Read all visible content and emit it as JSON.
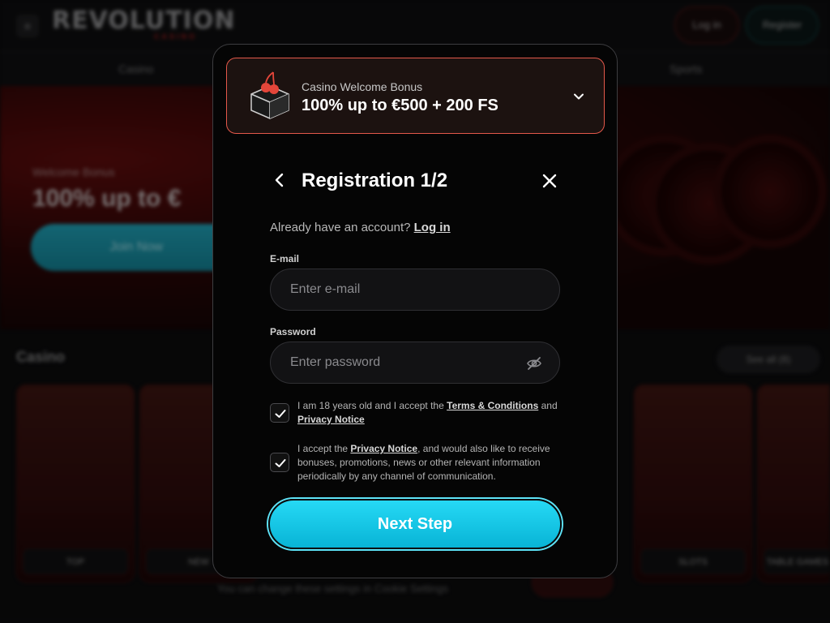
{
  "background": {
    "logo": "REVOLUTION",
    "logo_sub": "CASINO",
    "login_button": "Log in",
    "register_button": "Register",
    "nav": [
      "Casino",
      "Sports"
    ],
    "hero_subtitle": "Welcome Bonus",
    "hero_title": "100% up to €",
    "hero_button": "Join Now",
    "section_title": "Casino",
    "see_all": "See all (8)",
    "cards": [
      "TOP",
      "NEW",
      "SLOTS",
      "TABLE GAMES"
    ],
    "cookie_text": "You can change these settings in Cookie Settings",
    "accept_button": "Accept all"
  },
  "bonus": {
    "subtitle": "Casino Welcome Bonus",
    "title": "100% up to €500 + 200 FS",
    "accent_color": "#e4584a"
  },
  "header": {
    "title": "Registration 1/2"
  },
  "account_prompt": {
    "text": "Already have an account?",
    "link": "Log in"
  },
  "email": {
    "label": "E-mail",
    "placeholder": "Enter e-mail",
    "value": ""
  },
  "password": {
    "label": "Password",
    "placeholder": "Enter password",
    "value": "",
    "toggle_icon": "eye-off-icon"
  },
  "consents": [
    {
      "checked": true,
      "prefix": "I am 18 years old and I accept the",
      "link1": "Terms & Conditions",
      "middle": "and",
      "link2": "Privacy Notice"
    },
    {
      "checked": true,
      "prefix": "I accept the",
      "link1": "Privacy Notice",
      "suffix": ", and would also like to receive bonuses, promotions, news or other relevant information periodically by any channel of communication."
    }
  ],
  "next_button": {
    "label": "Next Step",
    "color": "#08b4d6"
  }
}
